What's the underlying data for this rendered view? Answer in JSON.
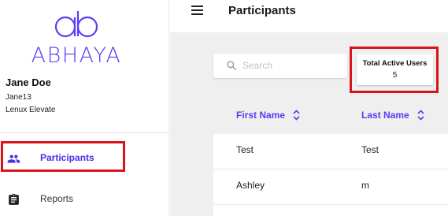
{
  "brand": {
    "logo_text": "ABHAYA",
    "accent_color": "#5b3df5"
  },
  "user": {
    "name": "Jane Doe",
    "username": "Jane13",
    "organization": "Lenux Elevate"
  },
  "sidebar": {
    "items": [
      {
        "label": "Participants",
        "icon": "people-icon",
        "active": true
      },
      {
        "label": "Reports",
        "icon": "clipboard-icon",
        "active": false
      }
    ]
  },
  "header": {
    "title": "Participants",
    "menu_icon": "hamburger-menu-icon"
  },
  "search": {
    "placeholder": "Search",
    "value": ""
  },
  "stats": {
    "total_active_users_label": "Total Active Users",
    "total_active_users_value": "5"
  },
  "table": {
    "columns": [
      "First Name",
      "Last Name"
    ],
    "rows": [
      [
        "Test",
        "Test"
      ],
      [
        "Ashley",
        "m"
      ],
      [
        "",
        ""
      ]
    ]
  },
  "highlight_color": "#d8141b"
}
